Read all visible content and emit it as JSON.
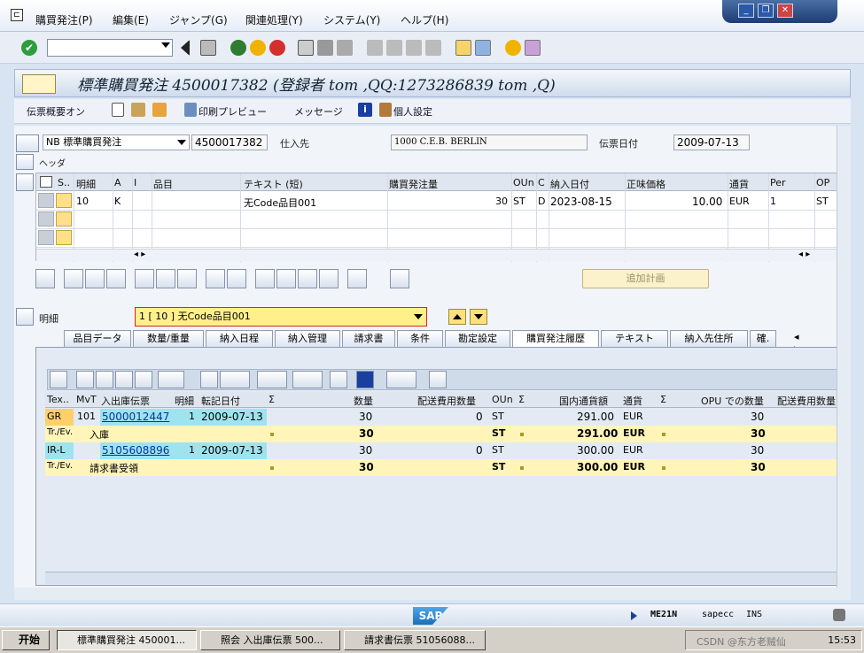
{
  "menu": {
    "items": [
      "購買発注(P)",
      "編集(E)",
      "ジャンプ(G)",
      "関連処理(Y)",
      "システム(Y)",
      "ヘルプ(H)"
    ]
  },
  "toolbar": {
    "command_value": ""
  },
  "title": "標準購買発注 4500017382 (登録者 tom ,QQ:1273286839 tom ,Q)",
  "app_toolbar": {
    "summary_label": "伝票概要オン",
    "print_preview_label": "印刷プレビュー",
    "messages_label": "メッセージ",
    "personal_settings_label": "個人設定"
  },
  "header": {
    "doc_type": "NB 標準購買発注",
    "po_number": "4500017382",
    "vendor_label": "仕入先",
    "vendor_value": "1000 C.E.B. BERLIN",
    "doc_date_label": "伝票日付",
    "doc_date_value": "2009-07-13",
    "header_section_label": "ヘッダ"
  },
  "items_grid": {
    "columns": [
      "S..",
      "明細",
      "A",
      "I",
      "品目",
      "テキスト (短)",
      "購買発注量",
      "OUn",
      "C",
      "納入日付",
      "正味価格",
      "通貨",
      "Per",
      "OP"
    ],
    "rows": [
      {
        "item": "10",
        "a": "K",
        "i": "",
        "material": "",
        "text": "无Code品目001",
        "qty": "30",
        "oun": "ST",
        "c": "D",
        "date": "2023-08-15",
        "price": "10.00",
        "currency": "EUR",
        "per": "1",
        "op": "ST"
      }
    ]
  },
  "add_plan_label": "追加計画",
  "item_detail": {
    "label": "明細",
    "selected": "1 [ 10 ] 无Code品目001"
  },
  "tabs": [
    "品目データ",
    "数量/重量",
    "納入日程",
    "納入管理",
    "請求書",
    "条件",
    "勘定設定",
    "購買発注履歴",
    "テキスト",
    "納入先住所",
    "確."
  ],
  "active_tab": "購買発注履歴",
  "history": {
    "columns": [
      "Tex..",
      "MvT",
      "入出庫伝票",
      "明細",
      "転記日付",
      "Σ",
      "数量",
      "配送費用数量",
      "OUn",
      "Σ",
      "国内通貨額",
      "通貨",
      "Σ",
      "OPU での数量",
      "配送費用数量"
    ],
    "rows": [
      {
        "type": "GR",
        "mvt": "101",
        "doc": "5000012447",
        "item": "1",
        "date": "2009-07-13",
        "qty": "30",
        "del_qty": "0",
        "oun": "ST",
        "amount": "291.00",
        "currency": "EUR",
        "opu_qty": "30"
      },
      {
        "type": "Tr./Ev.",
        "label": "入庫",
        "qty": "30",
        "oun": "ST",
        "amount": "291.00",
        "currency": "EUR",
        "opu_qty": "30"
      },
      {
        "type": "IR-L",
        "mvt": "",
        "doc": "5105608896",
        "item": "1",
        "date": "2009-07-13",
        "qty": "30",
        "del_qty": "0",
        "oun": "ST",
        "amount": "300.00",
        "currency": "EUR",
        "opu_qty": "30"
      },
      {
        "type": "Tr./Ev.",
        "label": "請求書受領",
        "qty": "30",
        "oun": "ST",
        "amount": "300.00",
        "currency": "EUR",
        "opu_qty": "30"
      }
    ]
  },
  "status": {
    "transaction": "ME21N",
    "system": "sapecc",
    "mode": "INS"
  },
  "taskbar": {
    "start_label": "开始",
    "tasks": [
      "標準購買発注 450001...",
      "照会 入出庫伝票 500...",
      "請求書伝票 51056088..."
    ],
    "clock": "15:53",
    "watermark": "CSDN @东方老贼仙"
  },
  "colors": {
    "accent": "#ffe08a",
    "highlight_cyan": "#9fe3ee",
    "total_row": "#fff5b8"
  }
}
